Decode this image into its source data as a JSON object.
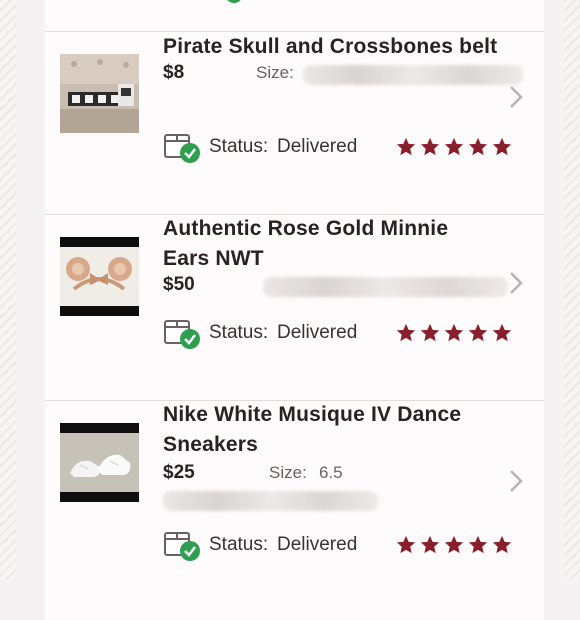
{
  "items": [
    {
      "title_lines": [
        "Pirate Skull and Crossbones belt"
      ],
      "price": "$8",
      "size_label": "Size:",
      "size_value": "",
      "status_label": "Status:",
      "status_value": "Delivered",
      "rating": 5,
      "thumb_icon": "belt-photo"
    },
    {
      "title_lines": [
        "Authentic Rose Gold Minnie",
        "Ears NWT"
      ],
      "price": "$50",
      "size_label": "",
      "size_value": "",
      "status_label": "Status:",
      "status_value": "Delivered",
      "rating": 5,
      "thumb_icon": "minnie-ears-photo"
    },
    {
      "title_lines": [
        "Nike White Musique IV Dance",
        "Sneakers"
      ],
      "price": "$25",
      "size_label": "Size:",
      "size_value": "6.5",
      "status_label": "Status:",
      "status_value": "Delivered",
      "rating": 5,
      "thumb_icon": "sneakers-photo"
    }
  ],
  "colors": {
    "star": "#8a1f2c",
    "check": "#2e9e4f",
    "chevron": "#b8b2b2"
  }
}
